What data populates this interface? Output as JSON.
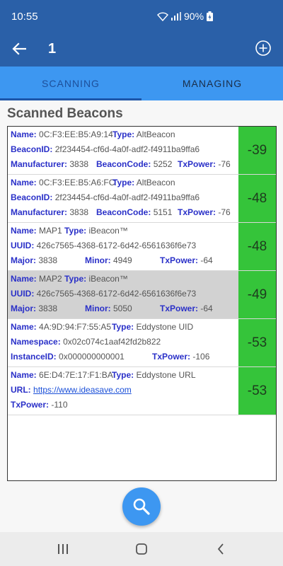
{
  "status": {
    "time": "10:55",
    "battery": "90%"
  },
  "app_bar": {
    "title": "1"
  },
  "tabs": [
    {
      "label": "SCANNING",
      "active": true
    },
    {
      "label": "MANAGING",
      "active": false
    }
  ],
  "section_title": "Scanned Beacons",
  "labels": {
    "name": "Name:",
    "type": "Type:",
    "beacon_id": "BeaconID:",
    "manufacturer": "Manufacturer:",
    "beacon_code": "BeaconCode:",
    "tx_power": "TxPower:",
    "uuid": "UUID:",
    "major": "Major:",
    "minor": "Minor:",
    "namespace": "Namespace:",
    "instance_id": "InstanceID:",
    "url": "URL:"
  },
  "beacons": [
    {
      "name": "0C:F3:EE:B5:A9:14",
      "type": "AltBeacon",
      "beacon_id": "2f234454-cf6d-4a0f-adf2-f4911ba9ffa6",
      "manufacturer": "3838",
      "beacon_code": "5252",
      "tx_power": "-76",
      "rssi": "-39"
    },
    {
      "name": "0C:F3:EE:B5:A6:FC",
      "type": "AltBeacon",
      "beacon_id": "2f234454-cf6d-4a0f-adf2-f4911ba9ffa6",
      "manufacturer": "3838",
      "beacon_code": "5151",
      "tx_power": "-76",
      "rssi": "-48"
    },
    {
      "name": "MAP1",
      "type": "iBeacon™",
      "uuid": "426c7565-4368-6172-6d42-6561636f6e73",
      "major": "3838",
      "minor": "4949",
      "tx_power": "-64",
      "rssi": "-48"
    },
    {
      "name": "MAP2",
      "type": "iBeacon™",
      "uuid": "426c7565-4368-6172-6d42-6561636f6e73",
      "major": "3838",
      "minor": "5050",
      "tx_power": "-64",
      "rssi": "-49",
      "selected": true
    },
    {
      "name": "4A:9D:94:F7:55:A5",
      "type": "Eddystone UID",
      "namespace": "0x02c074c1aaf42fd2b822",
      "instance_id": "0x000000000001",
      "tx_power": "-106",
      "rssi": "-53"
    },
    {
      "name": "6E:D4:7E:17:F1:BA",
      "type": "Eddystone URL",
      "url": "https://www.ideasave.com",
      "tx_power": "-110",
      "rssi": "-53"
    }
  ],
  "icons": {
    "back": "arrow-left-icon",
    "add": "plus-circle-icon",
    "fab": "search-icon",
    "nav": [
      "recent-apps-icon",
      "home-icon",
      "back-icon"
    ]
  },
  "colors": {
    "app_bar": "#2a60a8",
    "tabs": "#3d97f1",
    "rssi_cell": "#35c43a",
    "key_text": "#2a30c8",
    "selected_row": "#d2d2d2"
  }
}
